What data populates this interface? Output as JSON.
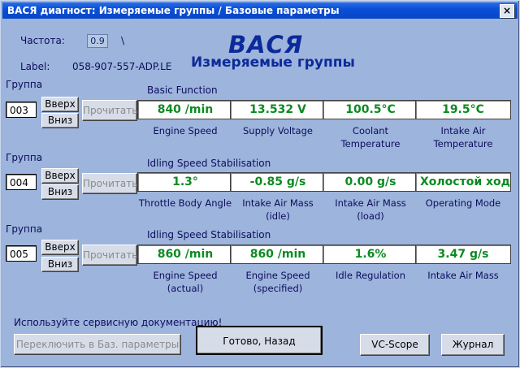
{
  "window": {
    "title": "ВАСЯ диагност: Измеряемые группы / Базовые параметры",
    "close_label": "×"
  },
  "header": {
    "freq_label": "Частота:",
    "freq_value": "0.9",
    "freq_indicator": "\\",
    "label_key": "Label:",
    "label_value": "058-907-557-ADP.LE",
    "logo": "ВАСЯ",
    "subtitle": "Измеряемые группы"
  },
  "groups": [
    {
      "group_label": "Группа",
      "group_number": "003",
      "up_label": "Вверх",
      "down_label": "Вниз",
      "read_label": "Прочитать",
      "section_title": "Basic Function",
      "fields": [
        {
          "value": "840 /min",
          "caption": "Engine Speed"
        },
        {
          "value": "13.532 V",
          "caption": "Supply Voltage"
        },
        {
          "value": "100.5°C",
          "caption": "Coolant Temperature"
        },
        {
          "value": "19.5°C",
          "caption": "Intake Air Temperature"
        }
      ]
    },
    {
      "group_label": "Группа",
      "group_number": "004",
      "up_label": "Вверх",
      "down_label": "Вниз",
      "read_label": "Прочитать",
      "section_title": "Idling Speed Stabilisation",
      "fields": [
        {
          "value": "1.3°",
          "caption": "Throttle Body Angle"
        },
        {
          "value": "-0.85 g/s",
          "caption": "Intake Air Mass (idle)"
        },
        {
          "value": "0.00 g/s",
          "caption": "Intake Air Mass (load)"
        },
        {
          "value": "Холостой ход",
          "caption": "Operating Mode"
        }
      ]
    },
    {
      "group_label": "Группа",
      "group_number": "005",
      "up_label": "Вверх",
      "down_label": "Вниз",
      "read_label": "Прочитать",
      "section_title": "Idling Speed Stabilisation",
      "fields": [
        {
          "value": "860 /min",
          "caption": "Engine Speed (actual)"
        },
        {
          "value": "860 /min",
          "caption": "Engine Speed (specified)"
        },
        {
          "value": "1.6%",
          "caption": "Idle Regulation"
        },
        {
          "value": "3.47 g/s",
          "caption": "Intake Air Mass"
        }
      ]
    }
  ],
  "footer": {
    "note": "Используйте сервисную документацию!",
    "switch_label": "Переключить в Баз. параметры",
    "done_label": "Готово, Назад",
    "vcscope_label": "VC-Scope",
    "journal_label": "Журнал"
  },
  "colors": {
    "value_green": "#0c8a22",
    "title_blue": "#0a4fd6",
    "background": "#9db4dc"
  }
}
